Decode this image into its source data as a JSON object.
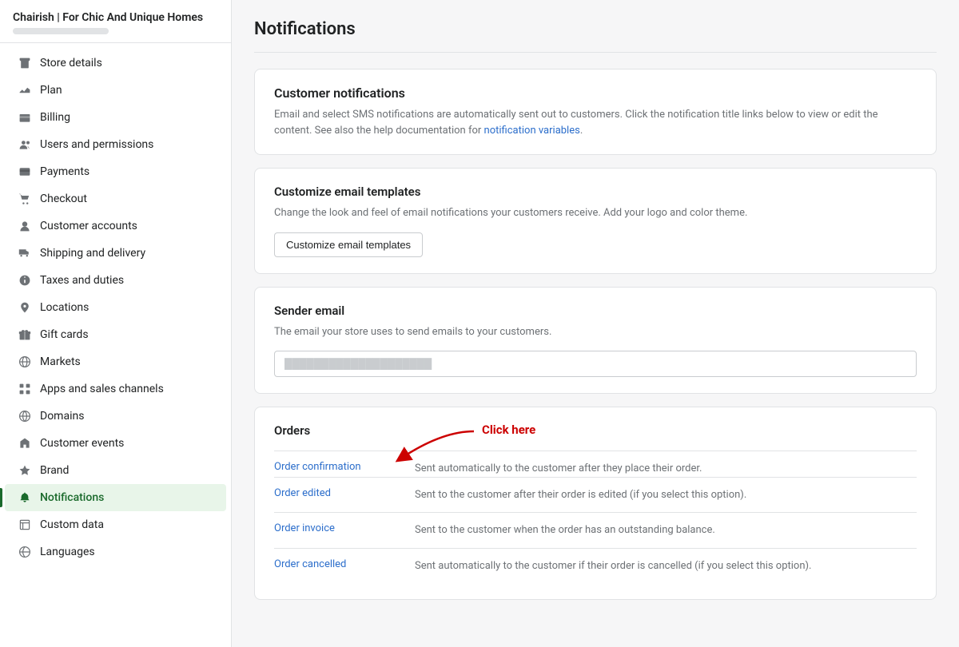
{
  "sidebar": {
    "store_name": "Chairish | For Chic And Unique Homes",
    "nav_items": [
      {
        "id": "store-details",
        "label": "Store details",
        "icon": "🏠",
        "active": false
      },
      {
        "id": "plan",
        "label": "Plan",
        "icon": "📊",
        "active": false
      },
      {
        "id": "billing",
        "label": "Billing",
        "icon": "💳",
        "active": false
      },
      {
        "id": "users-permissions",
        "label": "Users and permissions",
        "icon": "👤",
        "active": false
      },
      {
        "id": "payments",
        "label": "Payments",
        "icon": "💲",
        "active": false
      },
      {
        "id": "checkout",
        "label": "Checkout",
        "icon": "🛒",
        "active": false
      },
      {
        "id": "customer-accounts",
        "label": "Customer accounts",
        "icon": "👤",
        "active": false
      },
      {
        "id": "shipping-delivery",
        "label": "Shipping and delivery",
        "icon": "🚚",
        "active": false
      },
      {
        "id": "taxes-duties",
        "label": "Taxes and duties",
        "icon": "💰",
        "active": false
      },
      {
        "id": "locations",
        "label": "Locations",
        "icon": "📍",
        "active": false
      },
      {
        "id": "gift-cards",
        "label": "Gift cards",
        "icon": "🎁",
        "active": false
      },
      {
        "id": "markets",
        "label": "Markets",
        "icon": "🌐",
        "active": false
      },
      {
        "id": "apps-sales",
        "label": "Apps and sales channels",
        "icon": "⚡",
        "active": false
      },
      {
        "id": "domains",
        "label": "Domains",
        "icon": "🌐",
        "active": false
      },
      {
        "id": "customer-events",
        "label": "Customer events",
        "icon": "🔧",
        "active": false
      },
      {
        "id": "brand",
        "label": "Brand",
        "icon": "🎨",
        "active": false
      },
      {
        "id": "notifications",
        "label": "Notifications",
        "icon": "🔔",
        "active": true
      },
      {
        "id": "custom-data",
        "label": "Custom data",
        "icon": "📋",
        "active": false
      },
      {
        "id": "languages",
        "label": "Languages",
        "icon": "🌍",
        "active": false
      }
    ]
  },
  "page": {
    "title": "Notifications",
    "customer_notifications": {
      "title": "Customer notifications",
      "description": "Email and select SMS notifications are automatically sent out to customers. Click the notification title links below to view or edit the content. See also the help documentation for",
      "link_text": "notification variables",
      "description_end": "."
    },
    "customize_card": {
      "title": "Customize email templates",
      "description": "Change the look and feel of email notifications your customers receive. Add your logo and color theme.",
      "button_label": "Customize email templates"
    },
    "sender_email_card": {
      "title": "Sender email",
      "description": "The email your store uses to send emails to your customers.",
      "email_placeholder": "████████████████████"
    },
    "orders_section": {
      "title": "Orders",
      "annotation_label": "Click here",
      "items": [
        {
          "id": "order-confirmation",
          "link": "Order confirmation",
          "description": "Sent automatically to the customer after they place their order."
        },
        {
          "id": "order-edited",
          "link": "Order edited",
          "description": "Sent to the customer after their order is edited (if you select this option)."
        },
        {
          "id": "order-invoice",
          "link": "Order invoice",
          "description": "Sent to the customer when the order has an outstanding balance."
        },
        {
          "id": "order-cancelled",
          "link": "Order cancelled",
          "description": "Sent automatically to the customer if their order is cancelled (if you select this option)."
        }
      ]
    }
  }
}
